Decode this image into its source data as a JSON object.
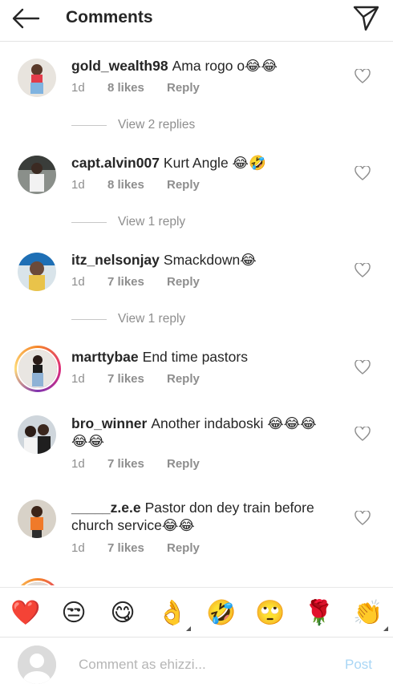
{
  "header": {
    "title": "Comments"
  },
  "comments": [
    {
      "username": "gold_wealth98",
      "text": "Ama rogo o😂😂",
      "text2": "",
      "time": "1d",
      "likes": "8 likes",
      "reply": "Reply",
      "replies": "View 2 replies"
    },
    {
      "username": "capt.alvin007",
      "text": "Kurt Angle 😂🤣",
      "text2": "",
      "time": "1d",
      "likes": "8 likes",
      "reply": "Reply",
      "replies": "View 1 reply"
    },
    {
      "username": "itz_nelsonjay",
      "text": "Smackdown😂",
      "text2": "",
      "time": "1d",
      "likes": "7 likes",
      "reply": "Reply",
      "replies": "View 1 reply"
    },
    {
      "username": "marttybae",
      "text": "End time pastors",
      "text2": "",
      "time": "1d",
      "likes": "7 likes",
      "reply": "Reply",
      "replies": ""
    },
    {
      "username": "bro_winner",
      "text": "Another indaboski 😂😂😂",
      "text2": "😂😂",
      "time": "1d",
      "likes": "7 likes",
      "reply": "Reply",
      "replies": ""
    },
    {
      "username": "_____z.e.e",
      "text": "Pastor don dey train before",
      "text2": "church service😂😂",
      "time": "1d",
      "likes": "7 likes",
      "reply": "Reply",
      "replies": ""
    }
  ],
  "emoji_bar": [
    "❤️",
    "😒",
    "😋",
    "👌",
    "🤣",
    "🙄",
    "🌹",
    "👏"
  ],
  "input": {
    "placeholder": "Comment as ehizzi...",
    "post_label": "Post"
  },
  "colors": {
    "meta": "#8e8e8e",
    "post_disabled": "#a9d6f5",
    "heart_red": "#ed4956"
  }
}
